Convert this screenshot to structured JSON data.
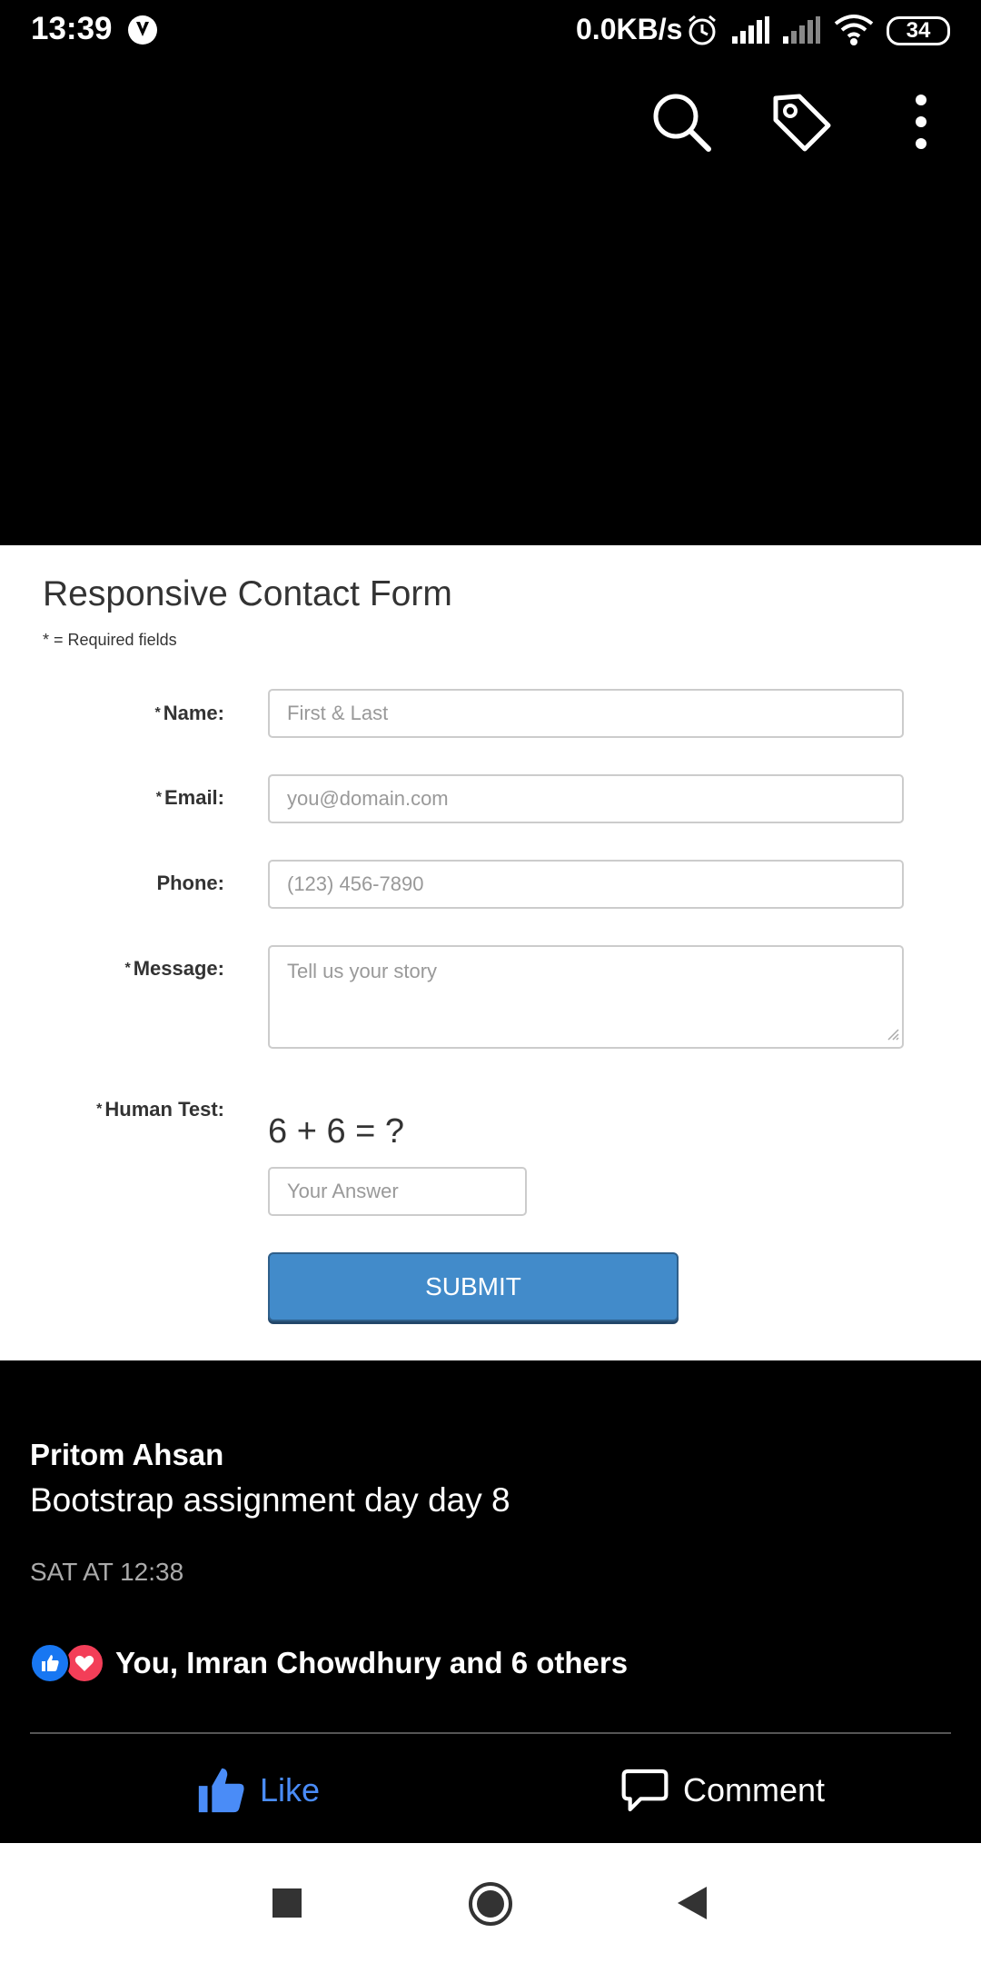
{
  "status_bar": {
    "time": "13:39",
    "network_speed": "0.0KB/s",
    "battery": "34"
  },
  "toolbar": {
    "icons": [
      "search-icon",
      "tag-icon",
      "more-vertical-icon"
    ]
  },
  "photo": {
    "form_title": "Responsive Contact Form",
    "required_note": "* = Required fields",
    "fields": {
      "name": {
        "label": "Name:",
        "required_mark": "*",
        "placeholder": "First & Last"
      },
      "email": {
        "label": "Email:",
        "required_mark": "*",
        "placeholder": "you@domain.com"
      },
      "phone": {
        "label": "Phone:",
        "placeholder": "(123) 456-7890"
      },
      "message": {
        "label": "Message:",
        "required_mark": "*",
        "placeholder": "Tell us your story"
      },
      "human_test": {
        "label": "Human Test:",
        "required_mark": "*",
        "question": "6 + 6 = ?",
        "placeholder": "Your Answer"
      }
    },
    "submit_label": "SUBMIT",
    "colors": {
      "submit": "#428bca"
    }
  },
  "post": {
    "author": "Pritom Ahsan",
    "caption": "Bootstrap assignment day day 8",
    "timestamp": "SAT AT 12:38",
    "reactions_text": "You, Imran Chowdhury and 6 others",
    "like_label": "Like",
    "comment_label": "Comment",
    "colors": {
      "like_active": "#4a8cf7",
      "like_reaction": "#1877f2",
      "love_reaction": "#f33e58"
    }
  },
  "nav_bar": {
    "icons": [
      "recent-apps-icon",
      "home-icon",
      "back-icon"
    ]
  }
}
